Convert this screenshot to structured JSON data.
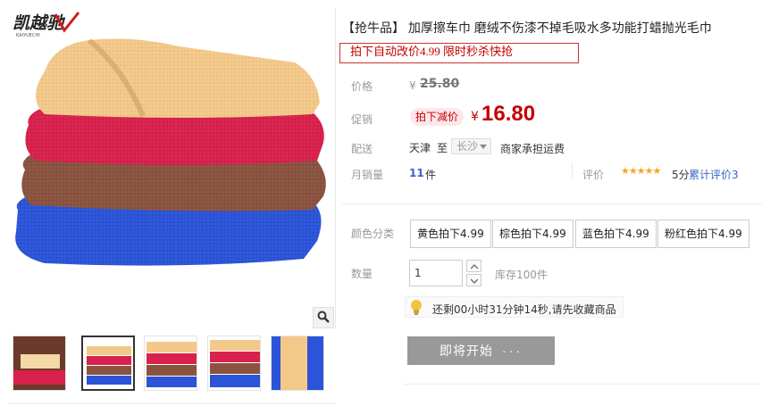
{
  "brand": {
    "logo_text": "凯越驰",
    "logo_sub": "KAIYUECHI"
  },
  "product": {
    "title": "【抢牛品】 加厚擦车巾 磨绒不伤漆不掉毛吸水多功能打蜡抛光毛巾",
    "promo_note": "拍下自动改价4.99 限时秒杀快抢",
    "price_label": "价格",
    "currency": "¥",
    "original_price": "25.80",
    "promo_label": "促销",
    "promo_badge": "拍下减价",
    "promo_price": "16.80",
    "ship_label": "配送",
    "ship_from": "天津",
    "ship_to_word": "至",
    "ship_city": "长沙",
    "ship_fee": "商家承担运费",
    "sales_label": "月销量",
    "sales_count": "11",
    "sales_unit": "件",
    "rate_label": "评价",
    "rate_stars": "★★★★★",
    "rate_score": "5分",
    "rate_count": "累计评价3",
    "color_label": "颜色分类",
    "color_options": [
      "黄色拍下4.99",
      "棕色拍下4.99",
      "蓝色拍下4.99",
      "粉红色拍下4.99"
    ],
    "qty_label": "数量",
    "qty_value": "1",
    "stock_text": "库存100件",
    "timer_text": "还剩00小时31分钟14秒,请先收藏商品",
    "start_button": "即将开始",
    "start_dots": "···"
  },
  "colors": {
    "price_red": "#c40000",
    "link_blue": "#3366cc",
    "star_orange": "#f5a623",
    "button_gray": "#999999",
    "towel_yellow": "#f3c98a",
    "towel_pink": "#d8214d",
    "towel_brown": "#8a5340",
    "towel_blue": "#2b54d8"
  },
  "icons": [
    "zoom-icon",
    "lightbulb-icon",
    "caret-down-icon",
    "arrow-up-icon",
    "arrow-down-icon"
  ]
}
